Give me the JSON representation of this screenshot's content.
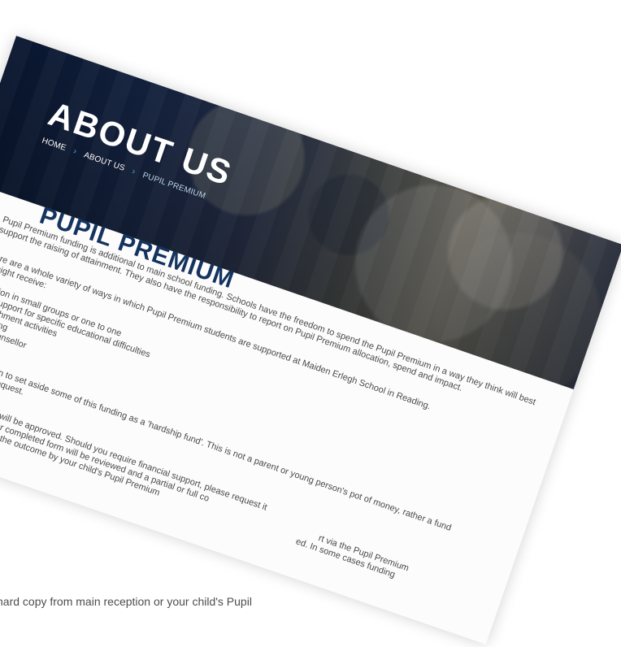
{
  "background_document": {
    "line": "hard copy from main reception or your child's Pupil"
  },
  "hero": {
    "title": "ABOUT US",
    "breadcrumbs": {
      "home": "HOME",
      "separator_1": "›",
      "about": "ABOUT US",
      "separator_2": "›",
      "current": "PUPIL PREMIUM"
    }
  },
  "main": {
    "title": "PUPIL PREMIUM",
    "intro_1": "Pupil Premium funding is additional to main school funding. Schools have the freedom to spend the Pupil Premium in a way they think will best",
    "intro_2": "support the raising of attainment. They also have the responsibility to report on Pupil Premium allocation, spend and impact.",
    "ways_1": "here are a whole variety of ways in which Pupil Premium students are supported at Maiden Erlegh School in Reading.",
    "ways_2": "y might receive:",
    "list": [
      "a tuition in small groups or one to one",
      "alist support for specific educational difficulties",
      "o enrichment activities",
      "mentoring",
      "om a counsellor"
    ],
    "fund_1": "have chosen to set aside some of this funding as a 'hardship fund'. This is not a parent or young person's pot of money, rather a fund",
    "fund_2": "ssed upon request.",
    "fund_3": "me full funding will be approved.  Should you require financial support, please request it",
    "fund_4": "quest Form.  Your completed form will be reviewed and a partial or full co",
    "fund_5": "will be notified of the outcome by your child's Pupil Premium",
    "fund_tail_1": "rt via the Pupil Premium",
    "fund_tail_2": "ed.  In some cases funding"
  }
}
